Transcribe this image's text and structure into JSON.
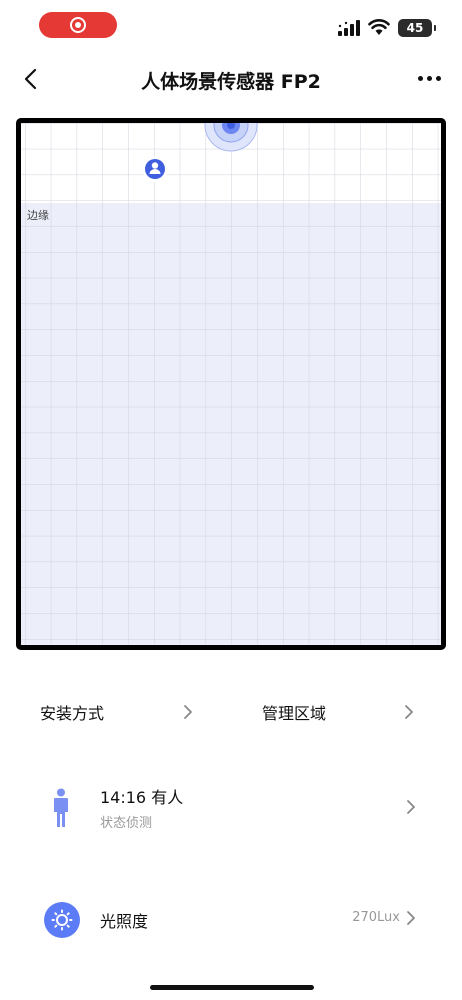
{
  "header": {
    "title": "人体场景传感器 FP2"
  },
  "status_bar": {
    "battery": "45"
  },
  "map": {
    "edge_label": "边缘"
  },
  "settings": {
    "install_label": "安装方式",
    "zones_label": "管理区域"
  },
  "presence": {
    "title": "14:16 有人",
    "subtitle": "状态侦测"
  },
  "light": {
    "label": "光照度",
    "value": "270Lux"
  },
  "colors": {
    "accent": "#5b7cf6",
    "record": "#e53935",
    "zone_fill": "#eceef9"
  },
  "icons": [
    "record-icon",
    "cellular-signal-icon",
    "wifi-icon",
    "battery-icon",
    "back-chevron-icon",
    "more-icon",
    "sensor-radar-icon",
    "person-target-icon",
    "chevron-right-icon",
    "standing-person-icon",
    "sun-icon"
  ]
}
